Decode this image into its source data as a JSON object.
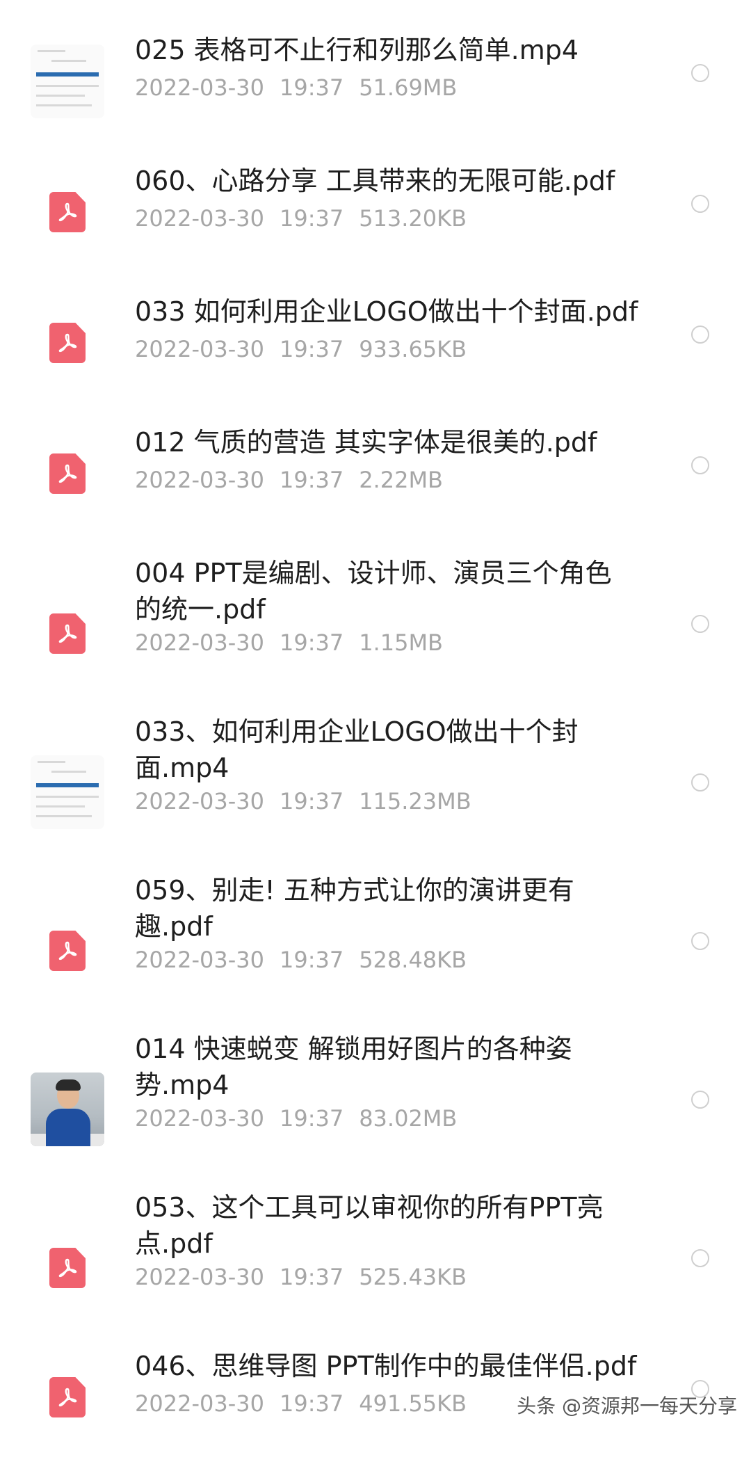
{
  "files": [
    {
      "title": "025 表格可不止行和列那么简单.mp4",
      "date": "2022-03-30",
      "time": "19:37",
      "size": "51.69MB",
      "thumb": "video-doc"
    },
    {
      "title": "060、心路分享 工具带来的无限可能.pdf",
      "date": "2022-03-30",
      "time": "19:37",
      "size": "513.20KB",
      "thumb": "pdf-icon"
    },
    {
      "title": "033 如何利用企业LOGO做出十个封面.pdf",
      "date": "2022-03-30",
      "time": "19:37",
      "size": "933.65KB",
      "thumb": "pdf-icon"
    },
    {
      "title": "012 气质的营造 其实字体是很美的.pdf",
      "date": "2022-03-30",
      "time": "19:37",
      "size": "2.22MB",
      "thumb": "pdf-icon"
    },
    {
      "title": "004 PPT是编剧、设计师、演员三个角色\n的统一.pdf",
      "date": "2022-03-30",
      "time": "19:37",
      "size": "1.15MB",
      "thumb": "pdf-icon"
    },
    {
      "title": "033、如何利用企业LOGO做出十个封\n面.mp4",
      "date": "2022-03-30",
      "time": "19:37",
      "size": "115.23MB",
      "thumb": "video-doc"
    },
    {
      "title": "059、别走! 五种方式让你的演讲更有\n趣.pdf",
      "date": "2022-03-30",
      "time": "19:37",
      "size": "528.48KB",
      "thumb": "pdf-icon"
    },
    {
      "title": "014 快速蜕变 解锁用好图片的各种姿\n势.mp4",
      "date": "2022-03-30",
      "time": "19:37",
      "size": "83.02MB",
      "thumb": "video-photo"
    },
    {
      "title": "053、这个工具可以审视你的所有PPT亮\n点.pdf",
      "date": "2022-03-30",
      "time": "19:37",
      "size": "525.43KB",
      "thumb": "pdf-icon"
    },
    {
      "title": "046、思维导图 PPT制作中的最佳伴侣.pdf",
      "date": "2022-03-30",
      "time": "19:37",
      "size": "491.55KB",
      "thumb": "pdf-icon"
    }
  ],
  "watermark": "头条 @资源邦一每天分享",
  "colors": {
    "pdf_icon": "#f0626f",
    "title": "#1e1e1e",
    "meta": "#a6a6a6",
    "radio_border": "#cfcfcf"
  }
}
